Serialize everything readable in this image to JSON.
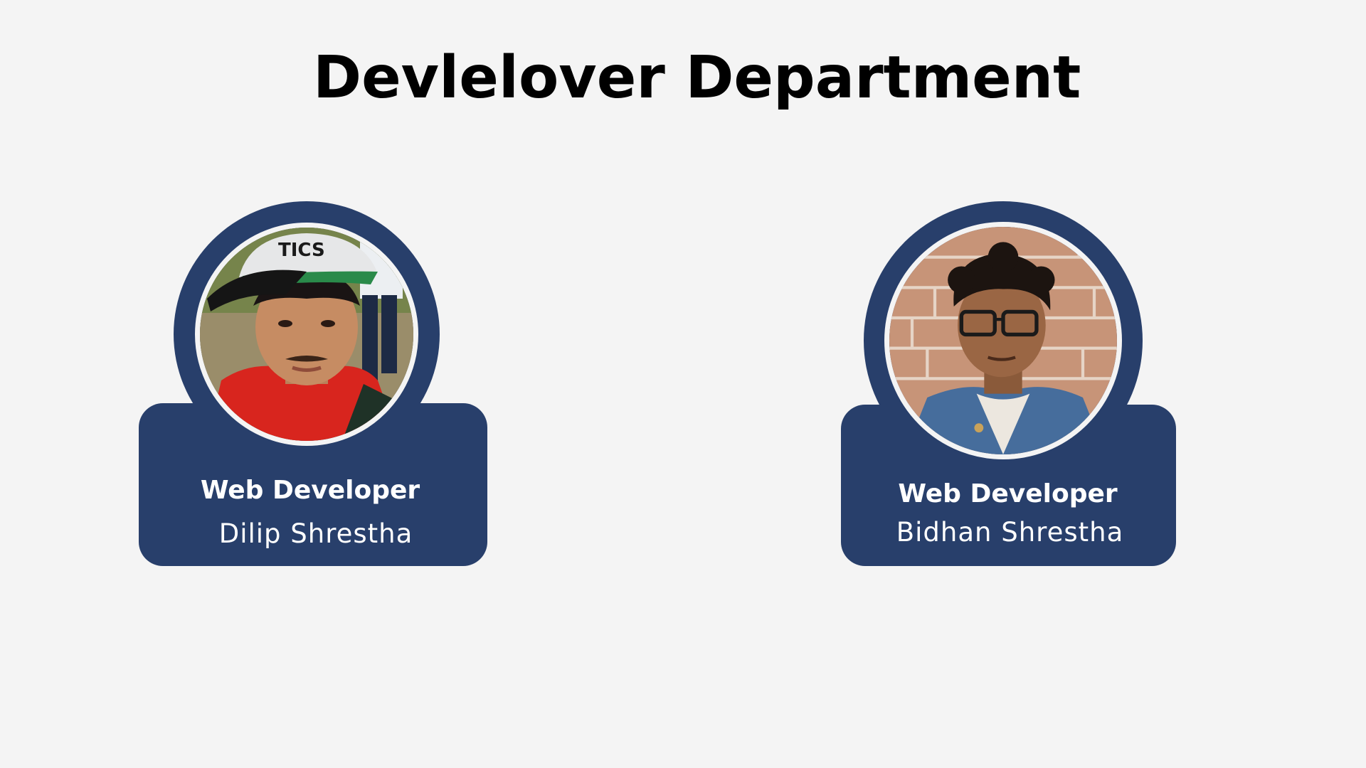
{
  "page": {
    "title": "Devlelover Department"
  },
  "members": [
    {
      "role": "Web Developer",
      "name": "Dilip Shrestha",
      "photo_icon": "portrait-photo-icon"
    },
    {
      "role": "Web Developer",
      "name": "Bidhan Shrestha",
      "photo_icon": "portrait-photo-icon"
    }
  ],
  "colors": {
    "background": "#f4f4f4",
    "card": "#283f6b",
    "title_text": "#000000",
    "card_text": "#ffffff"
  }
}
